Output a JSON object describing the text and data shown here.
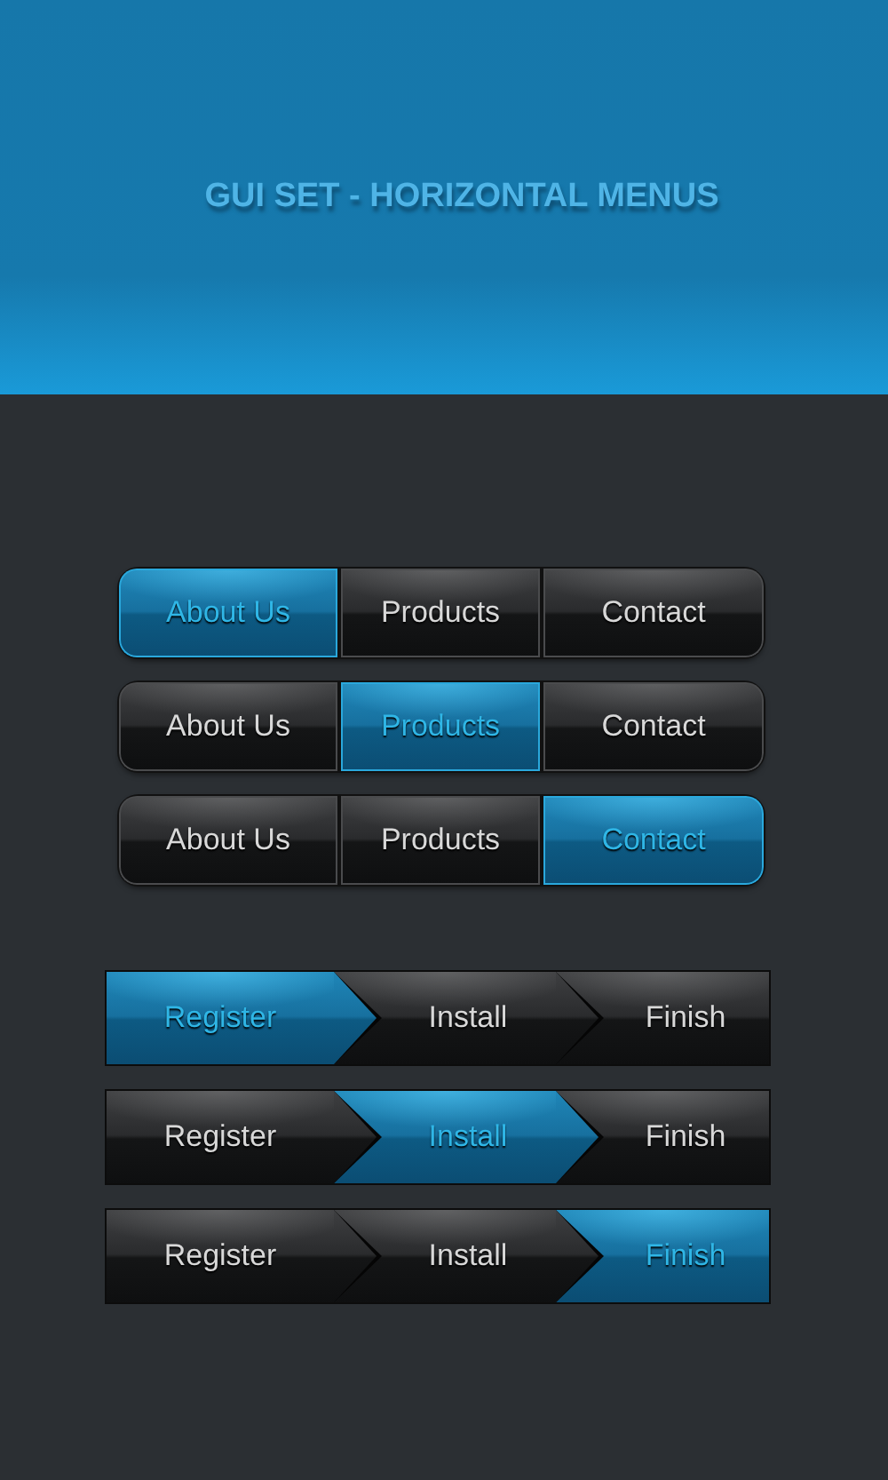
{
  "title": "GUI SET - HORIZONTAL MENUS",
  "tab_menus": [
    {
      "items": [
        {
          "label": "About Us",
          "selected": true
        },
        {
          "label": "Products",
          "selected": false
        },
        {
          "label": "Contact",
          "selected": false
        }
      ]
    },
    {
      "items": [
        {
          "label": "About Us",
          "selected": false
        },
        {
          "label": "Products",
          "selected": true
        },
        {
          "label": "Contact",
          "selected": false
        }
      ]
    },
    {
      "items": [
        {
          "label": "About Us",
          "selected": false
        },
        {
          "label": "Products",
          "selected": false
        },
        {
          "label": "Contact",
          "selected": true
        }
      ]
    }
  ],
  "step_menus": [
    {
      "items": [
        {
          "label": "Register",
          "selected": true
        },
        {
          "label": "Install",
          "selected": false
        },
        {
          "label": "Finish",
          "selected": false
        }
      ]
    },
    {
      "items": [
        {
          "label": "Register",
          "selected": false
        },
        {
          "label": "Install",
          "selected": true
        },
        {
          "label": "Finish",
          "selected": false
        }
      ]
    },
    {
      "items": [
        {
          "label": "Register",
          "selected": false
        },
        {
          "label": "Install",
          "selected": false
        },
        {
          "label": "Finish",
          "selected": true
        }
      ]
    }
  ]
}
